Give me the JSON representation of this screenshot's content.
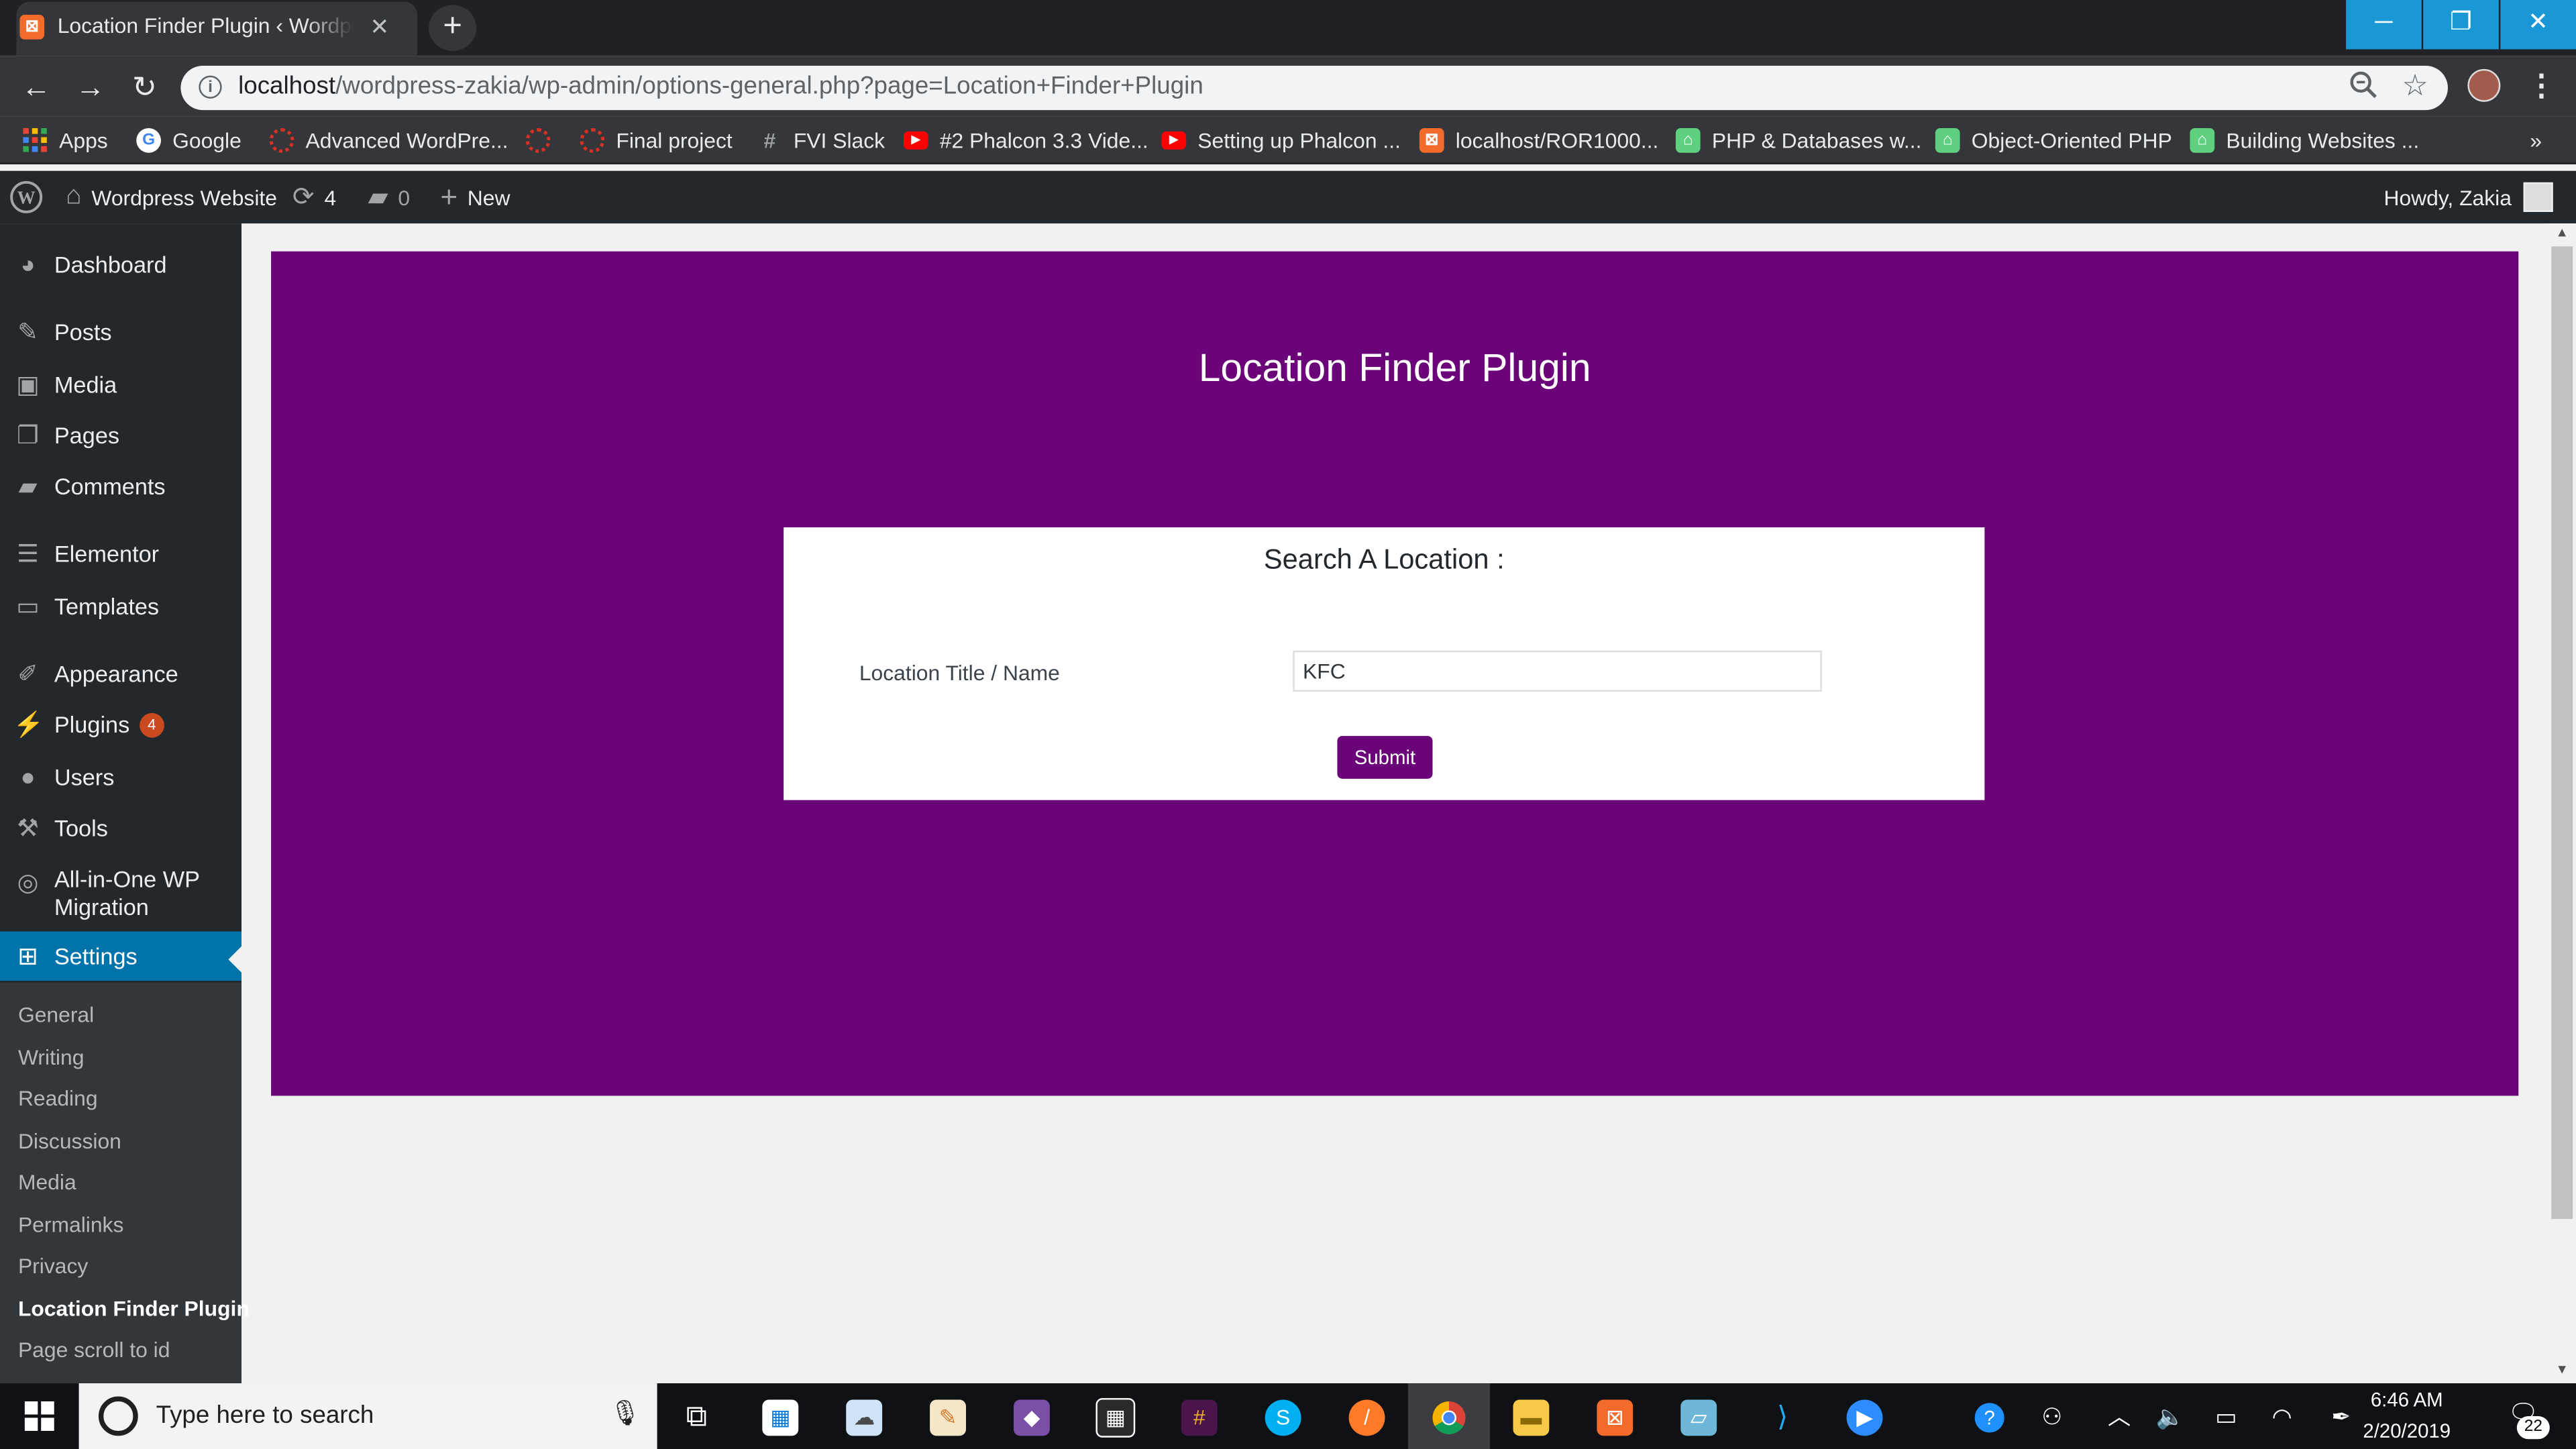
{
  "browser": {
    "tab_title": "Location Finder Plugin ‹ Wordpress Website",
    "tab_favicon": "xampp",
    "url_host": "localhost",
    "url_path": "/wordpress-zakia/wp-admin/options-general.php?page=Location+Finder+Plugin",
    "bookmarks": [
      {
        "label": "Apps",
        "icon": "apps-grid-icon",
        "color": "#e8453c"
      },
      {
        "label": "Google",
        "icon": "google-icon",
        "color": "#4285f4"
      },
      {
        "label": "Advanced WordPre...",
        "icon": "globe-icon",
        "color": "#d93025"
      },
      {
        "label": "",
        "icon": "globe-icon",
        "color": "#d93025"
      },
      {
        "label": "Final project",
        "icon": "globe-icon",
        "color": "#d93025"
      },
      {
        "label": "FVI Slack",
        "icon": "slack-hash-icon",
        "color": "#4a154b"
      },
      {
        "label": "#2 Phalcon 3.3 Vide...",
        "icon": "youtube-icon",
        "color": "#ff0000"
      },
      {
        "label": "Setting up Phalcon ...",
        "icon": "youtube-icon",
        "color": "#ff0000"
      },
      {
        "label": "localhost/ROR1000...",
        "icon": "xampp-icon",
        "color": "#f26b2b"
      },
      {
        "label": "PHP & Databases w...",
        "icon": "treehouse-icon",
        "color": "#5fcf80"
      },
      {
        "label": "Object-Oriented PHP",
        "icon": "treehouse-icon",
        "color": "#5fcf80"
      },
      {
        "label": "Building Websites ...",
        "icon": "treehouse-icon",
        "color": "#5fcf80"
      }
    ],
    "more_bookmarks": "»"
  },
  "adminbar": {
    "site_name": "Wordpress Website",
    "updates_count": "4",
    "comments_count": "0",
    "new_label": "New",
    "howdy": "Howdy, Zakia"
  },
  "menu": {
    "dashboard": "Dashboard",
    "posts": "Posts",
    "media": "Media",
    "pages": "Pages",
    "comments": "Comments",
    "elementor": "Elementor",
    "templates": "Templates",
    "appearance": "Appearance",
    "plugins": "Plugins",
    "plugins_badge": "4",
    "users": "Users",
    "tools": "Tools",
    "migration_line1": "All-in-One WP",
    "migration_line2": "Migration",
    "settings": "Settings",
    "submenu": [
      "General",
      "Writing",
      "Reading",
      "Discussion",
      "Media",
      "Permalinks",
      "Privacy",
      "Location Finder Plugin",
      "Page scroll to id"
    ]
  },
  "plugin": {
    "title": "Location Finder Plugin",
    "search_heading": "Search A Location :",
    "field_label": "Location Title / Name",
    "field_value": "KFC",
    "submit_label": "Submit",
    "panel_color": "#6a0478"
  },
  "taskbar": {
    "search_placeholder": "Type here to search",
    "time": "6:46 AM",
    "date": "2/20/2019",
    "notification_count": "22"
  }
}
